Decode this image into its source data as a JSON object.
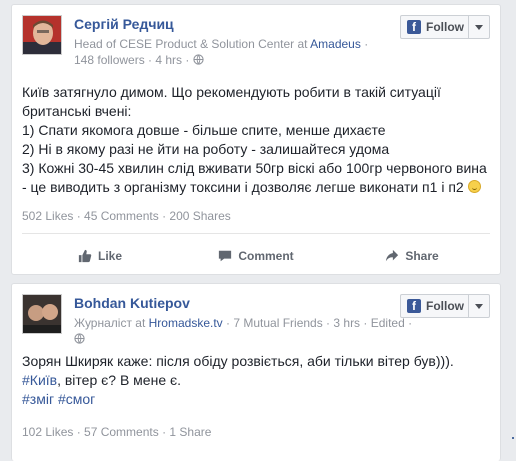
{
  "post1": {
    "author": "Сергій Редчиц",
    "subtitle_role": "Head of CESE Product & Solution Center at",
    "subtitle_company": "Amadeus",
    "subtitle_followers": "· 148 followers · 4 hrs ·",
    "follow_label": "Follow",
    "body_lines": [
      "Київ затягнуло димом. Що рекомендують робити в такій ситуації",
      "британські вчені:",
      "1) Спати якомога довше - більше спите, менше дихаєте",
      "2) Ні в якому разі не йти на роботу - залишайтеся удома",
      "3) Кожні 30-45 хвилин слід вживати 50гр віскі або 100гр червоного вина",
      "- це виводить з організму токсини і дозволяє легше виконати п1 і п2"
    ],
    "stats": "502 Likes · 45 Comments · 200 Shares",
    "actions": {
      "like": "Like",
      "comment": "Comment",
      "share": "Share"
    }
  },
  "post2": {
    "author": "Bohdan Kutiepov",
    "subtitle_role": "Журналіст at",
    "subtitle_company": "Hromadske.tv",
    "subtitle_rest": "· 7 Mutual Friends · 3 hrs · Edited ·",
    "follow_label": "Follow",
    "body_line1": "Зорян Шкиряк каже: після обіду розвіється, аби тільки вітер був))).",
    "body_tag1": "#Київ",
    "body_line2_rest": ", вітер є? В мене є.",
    "body_tag2": "#зміг",
    "body_tag3": "#смог",
    "stats": "102 Likes · 57 Comments · 1 Share"
  },
  "colors": {
    "link": "#365899",
    "meta": "#90949c",
    "facebook": "#3b5998"
  },
  "icons": [
    "facebook-icon",
    "chevron-down-icon",
    "like-icon",
    "comment-icon",
    "share-icon",
    "globe-icon",
    "smiley-icon"
  ]
}
